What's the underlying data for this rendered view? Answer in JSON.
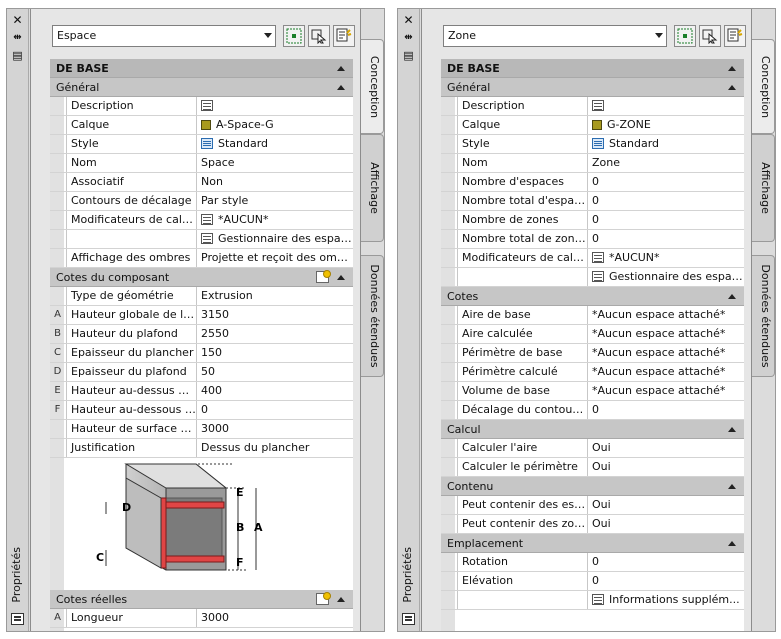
{
  "palette_left": {
    "title": "Propriétés",
    "selector": "Espace",
    "tabs": [
      "Conception",
      "Affichage",
      "Données étendues"
    ],
    "section_main": "DE BASE",
    "cat_general": "Général",
    "general_rows": [
      {
        "label": "Description",
        "value": "",
        "icon": "table-icon"
      },
      {
        "label": "Calque",
        "value": "A-Space-G",
        "icon": "layer-icon"
      },
      {
        "label": "Style",
        "value": "Standard",
        "icon": "style-icon"
      },
      {
        "label": "Nom",
        "value": "Space"
      },
      {
        "label": "Associatif",
        "value": "Non"
      },
      {
        "label": "Contours de décalage",
        "value": "Par style"
      },
      {
        "label": "Modificateurs de calcul",
        "value": "*AUCUN*",
        "icon": "table-icon"
      },
      {
        "label": "",
        "value": "Gestionnaire des espac...",
        "icon": "table-icon"
      },
      {
        "label": "Affichage des ombres",
        "value": "Projette et reçoit des ombr..."
      }
    ],
    "cat_cotes": "Cotes du composant",
    "cotes_rows": [
      {
        "letter": "",
        "label": "Type de géométrie",
        "value": "Extrusion"
      },
      {
        "letter": "A",
        "label": "Hauteur globale de l'e...",
        "value": "3150"
      },
      {
        "letter": "B",
        "label": "Hauteur du plafond",
        "value": "2550"
      },
      {
        "letter": "C",
        "label": "Epaisseur du plancher",
        "value": "150"
      },
      {
        "letter": "D",
        "label": "Epaisseur du plafond",
        "value": "50"
      },
      {
        "letter": "E",
        "label": "Hauteur au-dessus du...",
        "value": "400"
      },
      {
        "letter": "F",
        "label": "Hauteur au-dessous d...",
        "value": "0"
      },
      {
        "letter": "",
        "label": "Hauteur de surface pa...",
        "value": "3000"
      },
      {
        "letter": "",
        "label": "Justification",
        "value": "Dessus du plancher"
      }
    ],
    "diagram_letters": [
      "D",
      "E",
      "B",
      "A",
      "C",
      "F"
    ],
    "cat_reelles": "Cotes réelles",
    "reelles_rows": [
      {
        "letter": "A",
        "label": "Longueur",
        "value": "3000"
      }
    ]
  },
  "palette_right": {
    "title": "Propriétés",
    "selector": "Zone",
    "tabs": [
      "Conception",
      "Affichage",
      "Données étendues"
    ],
    "section_main": "DE BASE",
    "cat_general": "Général",
    "general_rows": [
      {
        "label": "Description",
        "value": "",
        "icon": "table-icon"
      },
      {
        "label": "Calque",
        "value": "G-ZONE",
        "icon": "layer-icon"
      },
      {
        "label": "Style",
        "value": "Standard",
        "icon": "style-icon"
      },
      {
        "label": "Nom",
        "value": "Zone"
      },
      {
        "label": "Nombre d'espaces",
        "value": "0"
      },
      {
        "label": "Nombre total d'espaces",
        "value": "0"
      },
      {
        "label": "Nombre de zones",
        "value": "0"
      },
      {
        "label": "Nombre total de zones",
        "value": "0"
      },
      {
        "label": "Modificateurs de calcul",
        "value": "*AUCUN*",
        "icon": "table-icon"
      },
      {
        "label": "",
        "value": "Gestionnaire des espac...",
        "icon": "table-icon"
      }
    ],
    "cat_cotes": "Cotes",
    "cotes_rows": [
      {
        "label": "Aire de base",
        "value": "*Aucun espace attaché*"
      },
      {
        "label": "Aire calculée",
        "value": "*Aucun espace attaché*"
      },
      {
        "label": "Périmètre de base",
        "value": "*Aucun espace attaché*"
      },
      {
        "label": "Périmètre calculé",
        "value": "*Aucun espace attaché*"
      },
      {
        "label": "Volume de base",
        "value": "*Aucun espace attaché*"
      },
      {
        "label": "Décalage du contour ...",
        "value": "0"
      }
    ],
    "cat_calcul": "Calcul",
    "calcul_rows": [
      {
        "label": "Calculer l'aire",
        "value": "Oui"
      },
      {
        "label": "Calculer le périmètre",
        "value": "Oui"
      }
    ],
    "cat_contenu": "Contenu",
    "contenu_rows": [
      {
        "label": "Peut contenir des esp...",
        "value": "Oui"
      },
      {
        "label": "Peut contenir des zones",
        "value": "Oui"
      }
    ],
    "cat_emplacement": "Emplacement",
    "emplacement_rows": [
      {
        "label": "Rotation",
        "value": "0"
      },
      {
        "label": "Elévation",
        "value": "0"
      },
      {
        "label": "",
        "value": "Informations supplém...",
        "icon": "table-icon"
      }
    ]
  }
}
